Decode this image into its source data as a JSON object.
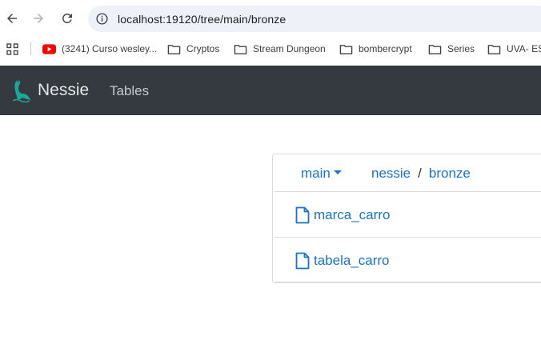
{
  "browser": {
    "url": "localhost:19120/tree/main/bronze"
  },
  "bookmarks": [
    {
      "label": "(3241) Curso wesley...",
      "icon": "youtube-icon"
    },
    {
      "label": "Cryptos",
      "icon": "folder-icon"
    },
    {
      "label": "Stream Dungeon",
      "icon": "folder-icon"
    },
    {
      "label": "bombercrypt",
      "icon": "folder-icon"
    },
    {
      "label": "Series",
      "icon": "folder-icon"
    },
    {
      "label": "UVA- ES",
      "icon": "folder-icon"
    }
  ],
  "navbar": {
    "brand": "Nessie",
    "links": [
      "Tables"
    ]
  },
  "tree": {
    "branch": "main",
    "breadcrumb": [
      "nessie",
      "bronze"
    ],
    "separator": "/",
    "items": [
      "marca_carro",
      "tabela_carro"
    ]
  },
  "colors": {
    "navbar_bg": "#343a40",
    "link": "#1a73c7",
    "omnibox_bg": "#eef1f8"
  }
}
